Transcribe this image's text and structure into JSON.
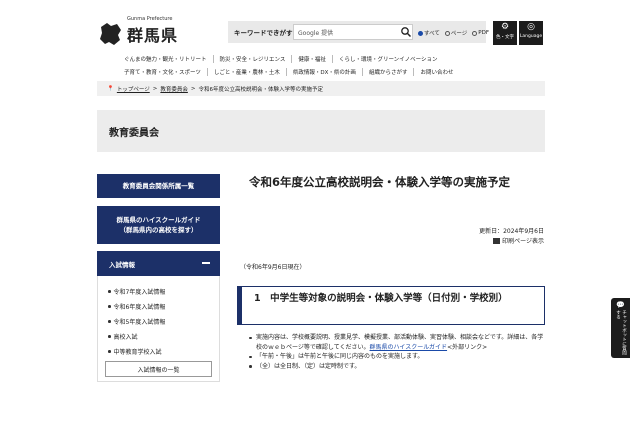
{
  "header": {
    "logo_sub": "Gunma Prefecture",
    "logo_text": "群馬県",
    "search_label": "キーワードできがす",
    "search_placeholder": "Google 提供",
    "radio_options": [
      "すべて",
      "ページ",
      "PDF"
    ],
    "radio_selected": "すべて",
    "color_button": "色・文字",
    "language_button": "Language"
  },
  "nav": {
    "row1": [
      "ぐんまの魅力・観光・リトリート",
      "防災・安全・レジリエンス",
      "健康・福祉",
      "くらし・環境・グリーンイノベーション"
    ],
    "row2": [
      "子育て・教育・文化・スポーツ",
      "しごと・産業・農林・土木",
      "県政情報・DX・県の計画",
      "組織からさがす",
      "お問い合わせ"
    ]
  },
  "breadcrumb": {
    "items": [
      "トップページ",
      "教育委員会",
      "令和6年度公立高校説明会・体験入学等の実施予定"
    ],
    "separator": ">"
  },
  "section": {
    "title": "教育委員会"
  },
  "sidebar": {
    "button1": "教育委員会関係所属一覧",
    "button2_line1": "群馬県のハイスクールガイド",
    "button2_line2": "（群馬県内の高校を探す）",
    "accordion_title": "入試情報",
    "items": [
      "令和7年度入試情報",
      "令和6年度入試情報",
      "令和5年度入試情報",
      "高校入試",
      "中等教育学校入試"
    ],
    "more_button": "入試情報の一覧"
  },
  "main": {
    "title": "令和6年度公立高校説明会・体験入学等の実施予定",
    "updated": "更新日：2024年9月6日",
    "print": "印刷ページ表示",
    "as_of": "（令和6年9月6日現在）",
    "heading2": "1　中学生等対象の説明会・体験入学等（日付別・学校別）",
    "note1_pre": "実施内容は、学校概要説明、授業見学、模擬授業、部活動体験、実習体験、相談会などです。詳細は、各学校のｗｅｂページ等で確認してください。",
    "note1_link": "群馬県のハイスクールガイド",
    "note1_post": "<外部リンク>",
    "note2": "「午前・午後」は午前と午後に同じ内容のものを実施します。",
    "note3": "（全）は全日制、（定）は定時制です。"
  },
  "chatbot": {
    "label": "チャットボットに質問する"
  }
}
